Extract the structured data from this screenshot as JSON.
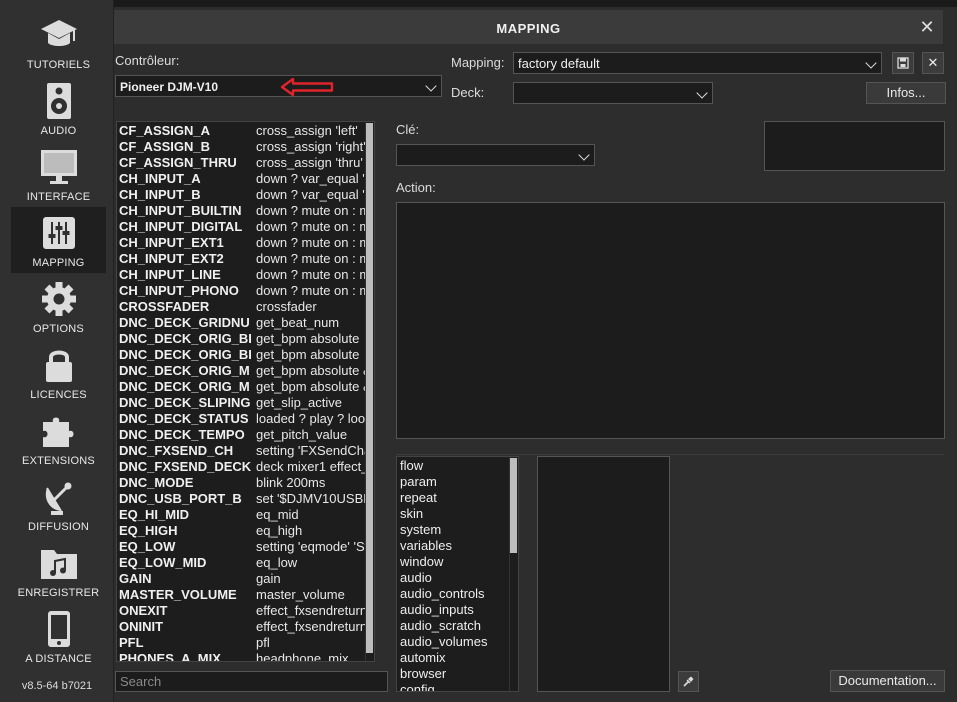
{
  "sidebar": {
    "items": [
      {
        "label": "TUTORIELS",
        "icon": "graduation-cap-icon"
      },
      {
        "label": "AUDIO",
        "icon": "speaker-icon"
      },
      {
        "label": "INTERFACE",
        "icon": "monitor-icon"
      },
      {
        "label": "MAPPING",
        "icon": "sliders-icon",
        "active": true
      },
      {
        "label": "OPTIONS",
        "icon": "gear-icon"
      },
      {
        "label": "LICENCES",
        "icon": "lock-icon"
      },
      {
        "label": "EXTENSIONS",
        "icon": "puzzle-icon"
      },
      {
        "label": "DIFFUSION",
        "icon": "satellite-dish-icon"
      },
      {
        "label": "ENREGISTRER",
        "icon": "music-folder-icon"
      },
      {
        "label": "A DISTANCE",
        "icon": "phone-icon"
      }
    ],
    "version": "v8.5-64 b7021"
  },
  "dialog": {
    "title": "MAPPING",
    "controller_label": "Contrôleur:",
    "controller_value": "Pioneer DJM-V10",
    "mapping_label": "Mapping:",
    "mapping_value": "factory default",
    "deck_label": "Deck:",
    "deck_value": "",
    "infos_button": "Infos...",
    "key_label": "Clé:",
    "key_value": "",
    "action_label": "Action:",
    "documentation_button": "Documentation...",
    "search_placeholder": "Search"
  },
  "keys": [
    {
      "name": "CF_ASSIGN_A",
      "action": "cross_assign 'left'"
    },
    {
      "name": "CF_ASSIGN_B",
      "action": "cross_assign 'right'"
    },
    {
      "name": "CF_ASSIGN_THRU",
      "action": "cross_assign 'thru'"
    },
    {
      "name": "CH_INPUT_A",
      "action": "down ? var_equal '$D"
    },
    {
      "name": "CH_INPUT_B",
      "action": "down ? var_equal '$D"
    },
    {
      "name": "CH_INPUT_BUILTIN",
      "action": "down ? mute on : mu"
    },
    {
      "name": "CH_INPUT_DIGITAL",
      "action": "down ? mute on : mu"
    },
    {
      "name": "CH_INPUT_EXT1",
      "action": "down ? mute on : mu"
    },
    {
      "name": "CH_INPUT_EXT2",
      "action": "down ? mute on : mu"
    },
    {
      "name": "CH_INPUT_LINE",
      "action": "down ? mute on : mu"
    },
    {
      "name": "CH_INPUT_PHONO",
      "action": "down ? mute on : mu"
    },
    {
      "name": "CROSSFADER",
      "action": "crossfader"
    },
    {
      "name": "DNC_DECK_GRIDNU",
      "action": "get_beat_num"
    },
    {
      "name": "DNC_DECK_ORIG_BI",
      "action": "get_bpm absolute"
    },
    {
      "name": "DNC_DECK_ORIG_BI",
      "action": "get_bpm absolute"
    },
    {
      "name": "DNC_DECK_ORIG_M",
      "action": "get_bpm absolute & p"
    },
    {
      "name": "DNC_DECK_ORIG_M",
      "action": "get_bpm absolute & p"
    },
    {
      "name": "DNC_DECK_SLIPING",
      "action": "get_slip_active"
    },
    {
      "name": "DNC_DECK_STATUS",
      "action": "loaded ? play ? loop '"
    },
    {
      "name": "DNC_DECK_TEMPO",
      "action": "get_pitch_value"
    },
    {
      "name": "DNC_FXSEND_CH",
      "action": "setting 'FXSendChan"
    },
    {
      "name": "DNC_FXSEND_DECK",
      "action": "deck mixer1 effect_fx"
    },
    {
      "name": "DNC_MODE",
      "action": "blink 200ms"
    },
    {
      "name": "DNC_USB_PORT_B",
      "action": "set '$DJMV10USBPE"
    },
    {
      "name": "EQ_HI_MID",
      "action": "eq_mid"
    },
    {
      "name": "EQ_HIGH",
      "action": "eq_high"
    },
    {
      "name": "EQ_LOW",
      "action": "setting 'eqmode' 'Ster"
    },
    {
      "name": "EQ_LOW_MID",
      "action": "eq_low"
    },
    {
      "name": "GAIN",
      "action": "gain"
    },
    {
      "name": "MASTER_VOLUME",
      "action": "master_volume"
    },
    {
      "name": "ONEXIT",
      "action": "effect_fxsendreturnde"
    },
    {
      "name": "ONINIT",
      "action": "effect_fxsendreturnde"
    },
    {
      "name": "PFL",
      "action": "pfl"
    },
    {
      "name": "PHONES_A_MIX",
      "action": "headphone_mix"
    }
  ],
  "categories": [
    "flow",
    "param",
    "repeat",
    "skin",
    "system",
    "variables",
    "window",
    "audio",
    "audio_controls",
    "audio_inputs",
    "audio_scratch",
    "audio_volumes",
    "automix",
    "browser",
    "config"
  ],
  "colors": {
    "accent_arrow": "#e0242b",
    "background": "#2d2d2d",
    "field": "#1c1c1c"
  }
}
